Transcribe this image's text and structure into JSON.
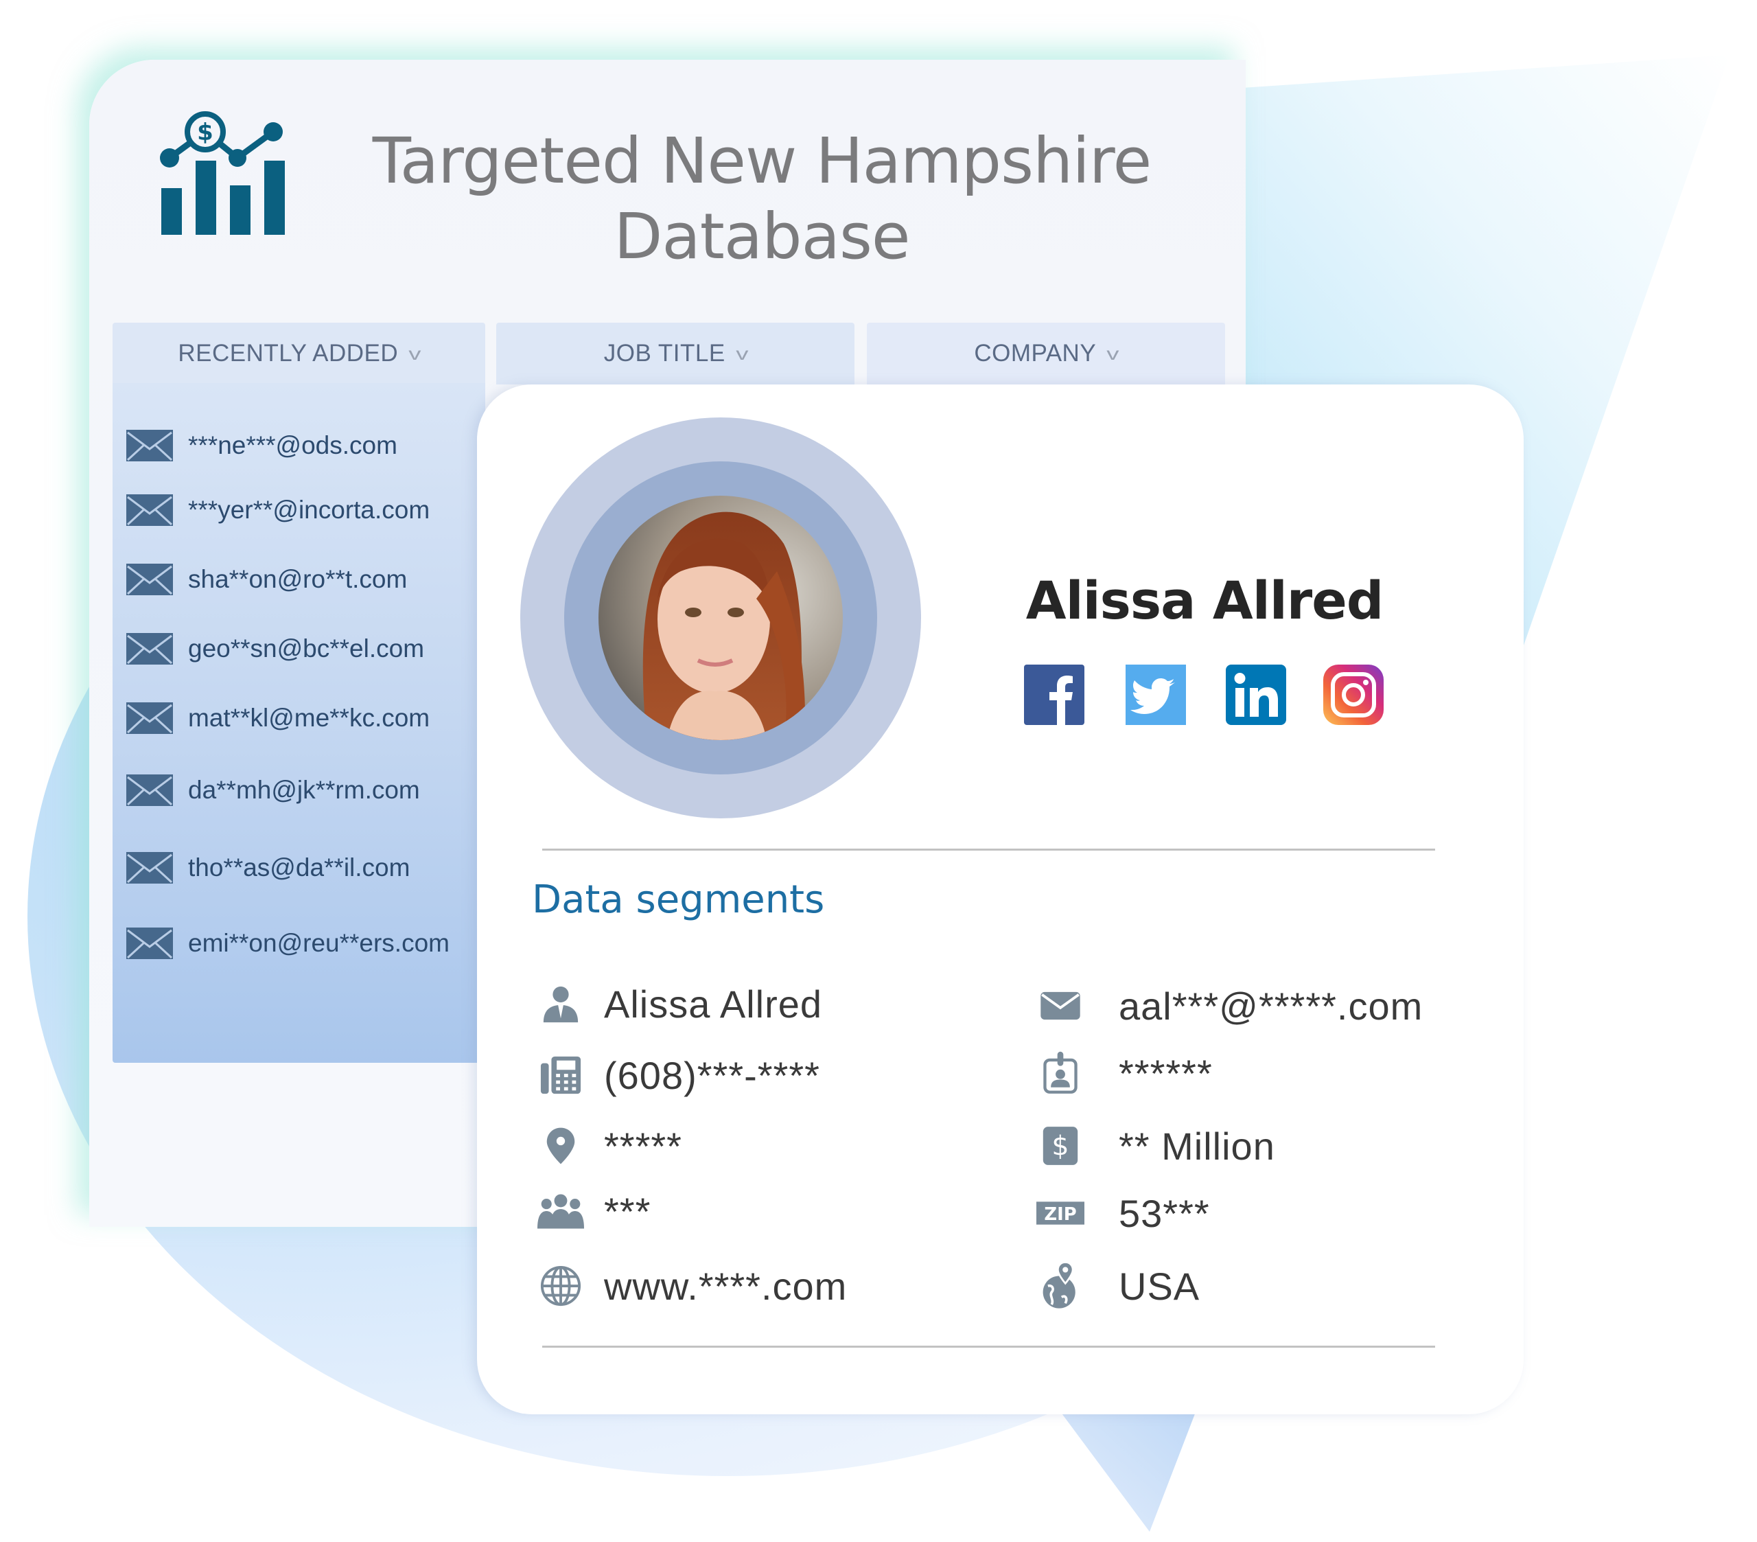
{
  "header": {
    "title_line1": "Targeted New Hampshire",
    "title_line2": "Database",
    "logo_icon": "chart-dollar-icon"
  },
  "tabs": [
    {
      "label": "RECENTLY ADDED",
      "icon": "chevron-down-icon"
    },
    {
      "label": "JOB TITLE",
      "icon": "chevron-down-icon"
    },
    {
      "label": "COMPANY",
      "icon": "chevron-down-icon"
    }
  ],
  "emails": [
    "***ne***@ods.com",
    "***yer**@incorta.com",
    "sha**on@ro**t.com",
    "geo**sn@bc**el.com",
    "mat**kl@me**kc.com",
    "da**mh@jk**rm.com",
    "tho**as@da**il.com",
    "emi**on@reu**ers.com"
  ],
  "profile": {
    "name": "Alissa Allred",
    "social": [
      {
        "name": "facebook",
        "icon": "facebook-icon",
        "color": "#3b5998"
      },
      {
        "name": "twitter",
        "icon": "twitter-icon",
        "color": "#55acee"
      },
      {
        "name": "linkedin",
        "icon": "linkedin-icon",
        "color": "#0077b5"
      },
      {
        "name": "instagram",
        "icon": "instagram-icon",
        "color": "#c13584"
      }
    ]
  },
  "segments": {
    "title": "Data segments",
    "left": [
      {
        "icon": "person-icon",
        "value": "Alissa Allred"
      },
      {
        "icon": "phone-icon",
        "value": "(608)***-****"
      },
      {
        "icon": "location-pin-icon",
        "value": "*****"
      },
      {
        "icon": "team-icon",
        "value": "***"
      },
      {
        "icon": "globe-icon",
        "value": "www.****.com"
      }
    ],
    "right": [
      {
        "icon": "email-icon",
        "value": "aal***@*****.com"
      },
      {
        "icon": "id-badge-icon",
        "value": "******"
      },
      {
        "icon": "dollar-icon",
        "value": "** Million"
      },
      {
        "icon": "zip-icon",
        "label": "ZIP",
        "value": "53***"
      },
      {
        "icon": "world-pin-icon",
        "value": "USA"
      }
    ]
  },
  "colors": {
    "accent": "#1d6ea3",
    "logo": "#0b6080",
    "icon_gray": "#7a8b99",
    "email_text": "#2c4a6e"
  }
}
